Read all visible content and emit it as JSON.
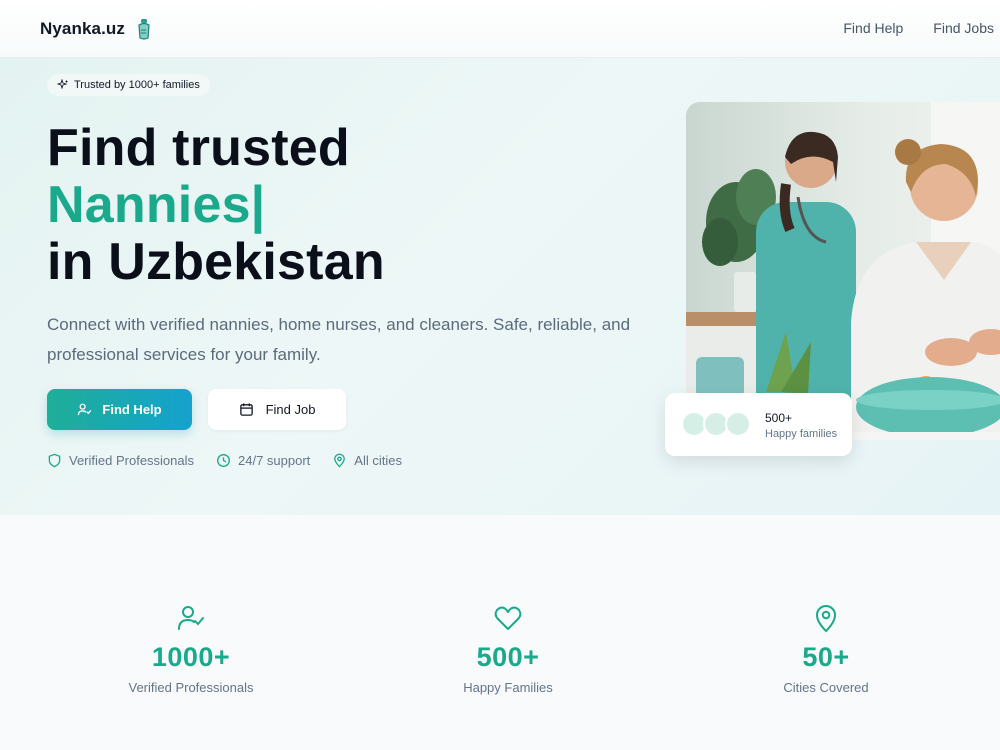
{
  "header": {
    "brand": "Nyanka.uz",
    "nav": [
      {
        "label": "Find Help"
      },
      {
        "label": "Find Jobs"
      }
    ]
  },
  "hero": {
    "badge": "Trusted by 1000+ families",
    "title_line1": "Find trusted",
    "title_accent": "Nannies|",
    "title_line3": "in Uzbekistan",
    "subtitle": "Connect with verified nannies, home nurses, and cleaners. Safe, reliable, and professional services for your family.",
    "primary_button": "Find Help",
    "secondary_button": "Find Job",
    "features": [
      {
        "icon": "shield-icon",
        "label": "Verified Professionals"
      },
      {
        "icon": "clock-icon",
        "label": "24/7 support"
      },
      {
        "icon": "map-pin-icon",
        "label": "All cities"
      }
    ],
    "photo_card": {
      "value": "500+",
      "label": "Happy families"
    }
  },
  "stats": [
    {
      "icon": "user-check-icon",
      "value": "1000+",
      "label": "Verified Professionals"
    },
    {
      "icon": "heart-icon",
      "value": "500+",
      "label": "Happy Families"
    },
    {
      "icon": "map-pin-icon",
      "value": "50+",
      "label": "Cities Covered"
    }
  ],
  "colors": {
    "accent": "#1aa98b",
    "button_gradient_start": "#1fae97",
    "button_gradient_end": "#14a2cf",
    "text_dark": "#0b0f19",
    "text_muted": "#64748b"
  }
}
